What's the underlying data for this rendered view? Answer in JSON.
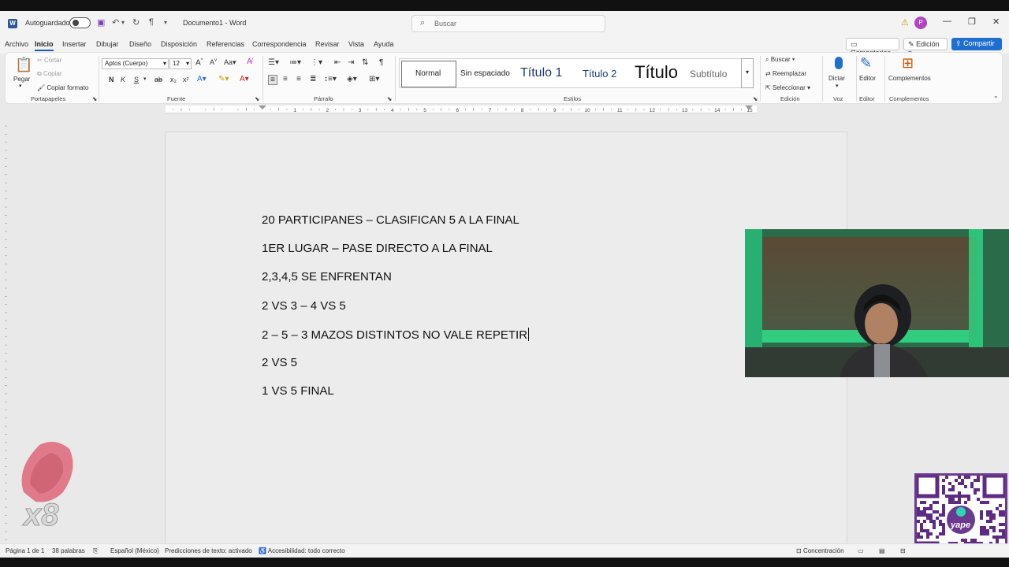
{
  "titlebar": {
    "autosave_label": "Autoguardado",
    "doc_title": "Documento1",
    "app_name": "Word",
    "search_placeholder": "Buscar",
    "avatar_initial": "P"
  },
  "menu": {
    "tabs": [
      "Archivo",
      "Inicio",
      "Insertar",
      "Dibujar",
      "Diseño",
      "Disposición",
      "Referencias",
      "Correspondencia",
      "Revisar",
      "Vista",
      "Ayuda"
    ],
    "active_tab": "Inicio",
    "comments_label": "Comentarios",
    "edit_label": "Edición",
    "share_label": "Compartir"
  },
  "ribbon": {
    "clipboard": {
      "paste": "Pegar",
      "cut": "Cortar",
      "copy": "Copiar",
      "format_painter": "Copiar formato",
      "group": "Portapapeles"
    },
    "font": {
      "font_name": "Aptos (Cuerpo)",
      "font_size": "12",
      "group": "Fuente"
    },
    "paragraph": {
      "group": "Párrafo"
    },
    "styles": {
      "items": [
        "Normal",
        "Sin espaciado",
        "Título 1",
        "Título 2",
        "Título",
        "Subtítulo"
      ],
      "group": "Estilos"
    },
    "editing": {
      "find": "Buscar",
      "replace": "Reemplazar",
      "select": "Seleccionar",
      "group": "Edición"
    },
    "voice": {
      "dictate": "Dictar",
      "group": "Voz"
    },
    "editor": {
      "label": "Editor",
      "group": "Editor"
    },
    "addins": {
      "label": "Complementos",
      "group": "Complementos"
    }
  },
  "ruler_numbers": [
    "1",
    "2",
    "3",
    "4",
    "5",
    "6",
    "7",
    "8",
    "9",
    "10",
    "11",
    "12",
    "13",
    "14",
    "15"
  ],
  "document": {
    "lines": [
      "20 PARTICIPANES – CLASIFICAN 5 A LA FINAL",
      "1ER LUGAR – PASE DIRECTO A LA FINAL",
      "2,3,4,5 SE ENFRENTAN",
      "2 VS 3 – 4 VS 5",
      "2 – 5 – 3 MAZOS DISTINTOS NO VALE REPETIR",
      "2 VS 5",
      "1 VS 5 FINAL"
    ]
  },
  "statusbar": {
    "page": "Página 1 de 1",
    "words": "38 palabras",
    "language": "Español (México)",
    "predictions": "Predicciones de texto: activado",
    "accessibility": "Accesibilidad: todo correcto",
    "focus": "Concentración"
  },
  "overlay": {
    "multiplier": "x8",
    "qr_brand": "yape"
  },
  "colors": {
    "accent": "#185abd",
    "share": "#1f6fd0",
    "webcam_glow": "#2fe08a",
    "qr_border": "#6b3a8f"
  }
}
